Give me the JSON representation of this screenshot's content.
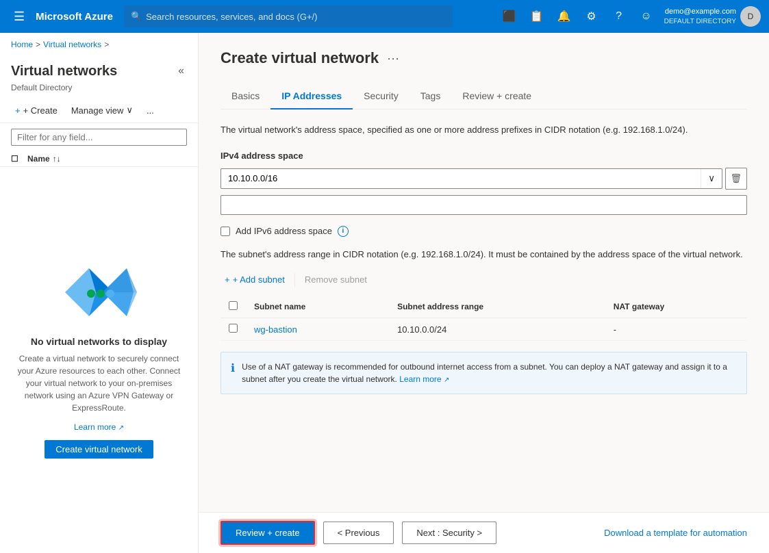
{
  "topbar": {
    "hamburger_label": "☰",
    "brand": "Microsoft Azure",
    "search_placeholder": "Search resources, services, and docs (G+/)",
    "user_email": "demo@example.com",
    "user_directory": "DEFAULT DIRECTORY",
    "user_initials": "D",
    "icons": [
      "📺",
      "📋",
      "🔔",
      "⚙",
      "?",
      "😊"
    ]
  },
  "breadcrumb": {
    "home": "Home",
    "sep1": ">",
    "vnet": "Virtual networks",
    "sep2": ">"
  },
  "sidebar": {
    "title": "Virtual networks",
    "subtitle": "Default Directory",
    "collapse_icon": "«",
    "create_label": "+ Create",
    "manage_view_label": "Manage view",
    "more_icon": "...",
    "filter_placeholder": "Filter for any field...",
    "name_col": "Name",
    "sort_icon": "↑↓",
    "empty_title": "No virtual networks to display",
    "empty_desc": "Create a virtual network to securely connect your Azure resources to each other. Connect your virtual network to your on-premises network using an Azure VPN Gateway or ExpressRoute.",
    "learn_more": "Learn more",
    "create_btn": "Create virtual network"
  },
  "main": {
    "title": "Create virtual network",
    "more_icon": "···",
    "tabs": [
      {
        "id": "basics",
        "label": "Basics"
      },
      {
        "id": "ip-addresses",
        "label": "IP Addresses"
      },
      {
        "id": "security",
        "label": "Security"
      },
      {
        "id": "tags",
        "label": "Tags"
      },
      {
        "id": "review-create",
        "label": "Review + create"
      }
    ],
    "active_tab": "ip-addresses",
    "form": {
      "desc": "The virtual network's address space, specified as one or more address prefixes in CIDR notation (e.g. 192.168.1.0/24).",
      "ipv4_label": "IPv4 address space",
      "ipv4_value": "10.10.0.0/16",
      "ipv4_placeholder": "",
      "add_ipv6_label": "Add IPv6 address space",
      "ipv6_info": "i",
      "subnet_desc": "The subnet's address range in CIDR notation (e.g. 192.168.1.0/24). It must be contained by the address space of the virtual network.",
      "add_subnet_label": "+ Add subnet",
      "remove_subnet_label": "Remove subnet",
      "table_headers": [
        "",
        "Subnet name",
        "Subnet address range",
        "NAT gateway"
      ],
      "subnets": [
        {
          "name": "wg-bastion",
          "address_range": "10.10.0.0/24",
          "nat_gateway": "-"
        }
      ],
      "info_banner_text": "Use of a NAT gateway is recommended for outbound internet access from a subnet. You can deploy a NAT gateway and assign it to a subnet after you create the virtual network.",
      "info_banner_link": "Learn more"
    }
  },
  "footer": {
    "review_create": "Review + create",
    "previous": "< Previous",
    "next": "Next : Security >",
    "download_template": "Download a template for automation"
  },
  "icons": {
    "info_circle": "ℹ",
    "trash": "🗑",
    "plus": "+",
    "chevron_down": "∨",
    "checkbox_empty": "☐"
  }
}
